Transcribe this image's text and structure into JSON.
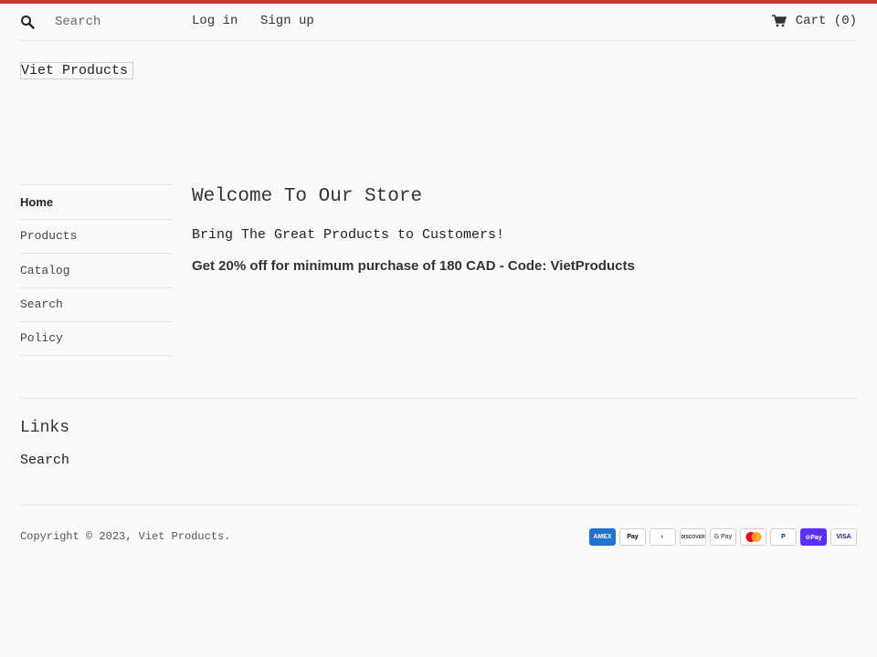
{
  "header": {
    "search_placeholder": "Search",
    "login": "Log in",
    "signup": "Sign up",
    "cart": "Cart (0)"
  },
  "logo": "Viet Products",
  "sidebar": {
    "items": [
      {
        "label": "Home"
      },
      {
        "label": "Products"
      },
      {
        "label": "Catalog"
      },
      {
        "label": "Search"
      },
      {
        "label": "Policy"
      }
    ]
  },
  "main": {
    "title": "Welcome To Our Store",
    "subtitle": "Bring The Great Products to Customers!",
    "promo": "Get 20% off for minimum purchase of 180 CAD - Code: VietProducts"
  },
  "footer": {
    "links_title": "Links",
    "links": [
      {
        "label": "Search"
      }
    ],
    "copyright": "Copyright © 2023, Viet Products.",
    "payments": [
      {
        "name": "amex-icon",
        "label": "AMEX",
        "bg": "#1f72cd",
        "fg": "#ffffff"
      },
      {
        "name": "apple-pay-icon",
        "label": " Pay",
        "bg": "#ffffff",
        "fg": "#000000"
      },
      {
        "name": "diners-club-icon",
        "label": "◐",
        "bg": "#ffffff",
        "fg": "#0079be"
      },
      {
        "name": "discover-icon",
        "label": "DISCOVER",
        "bg": "#ffffff",
        "fg": "#333333"
      },
      {
        "name": "google-pay-icon",
        "label": "G Pay",
        "bg": "#ffffff",
        "fg": "#5f6368"
      },
      {
        "name": "mastercard-icon",
        "label": "",
        "bg": "#ffffff",
        "fg": "#eb001b"
      },
      {
        "name": "paypal-icon",
        "label": "P",
        "bg": "#ffffff",
        "fg": "#003087"
      },
      {
        "name": "shop-pay-icon",
        "label": "⊙Pay",
        "bg": "#5a31f4",
        "fg": "#ffffff"
      },
      {
        "name": "visa-icon",
        "label": "VISA",
        "bg": "#ffffff",
        "fg": "#1a1f71"
      }
    ]
  },
  "colors": {
    "accent": "#c0392b",
    "divider": "#e2e2e2"
  }
}
